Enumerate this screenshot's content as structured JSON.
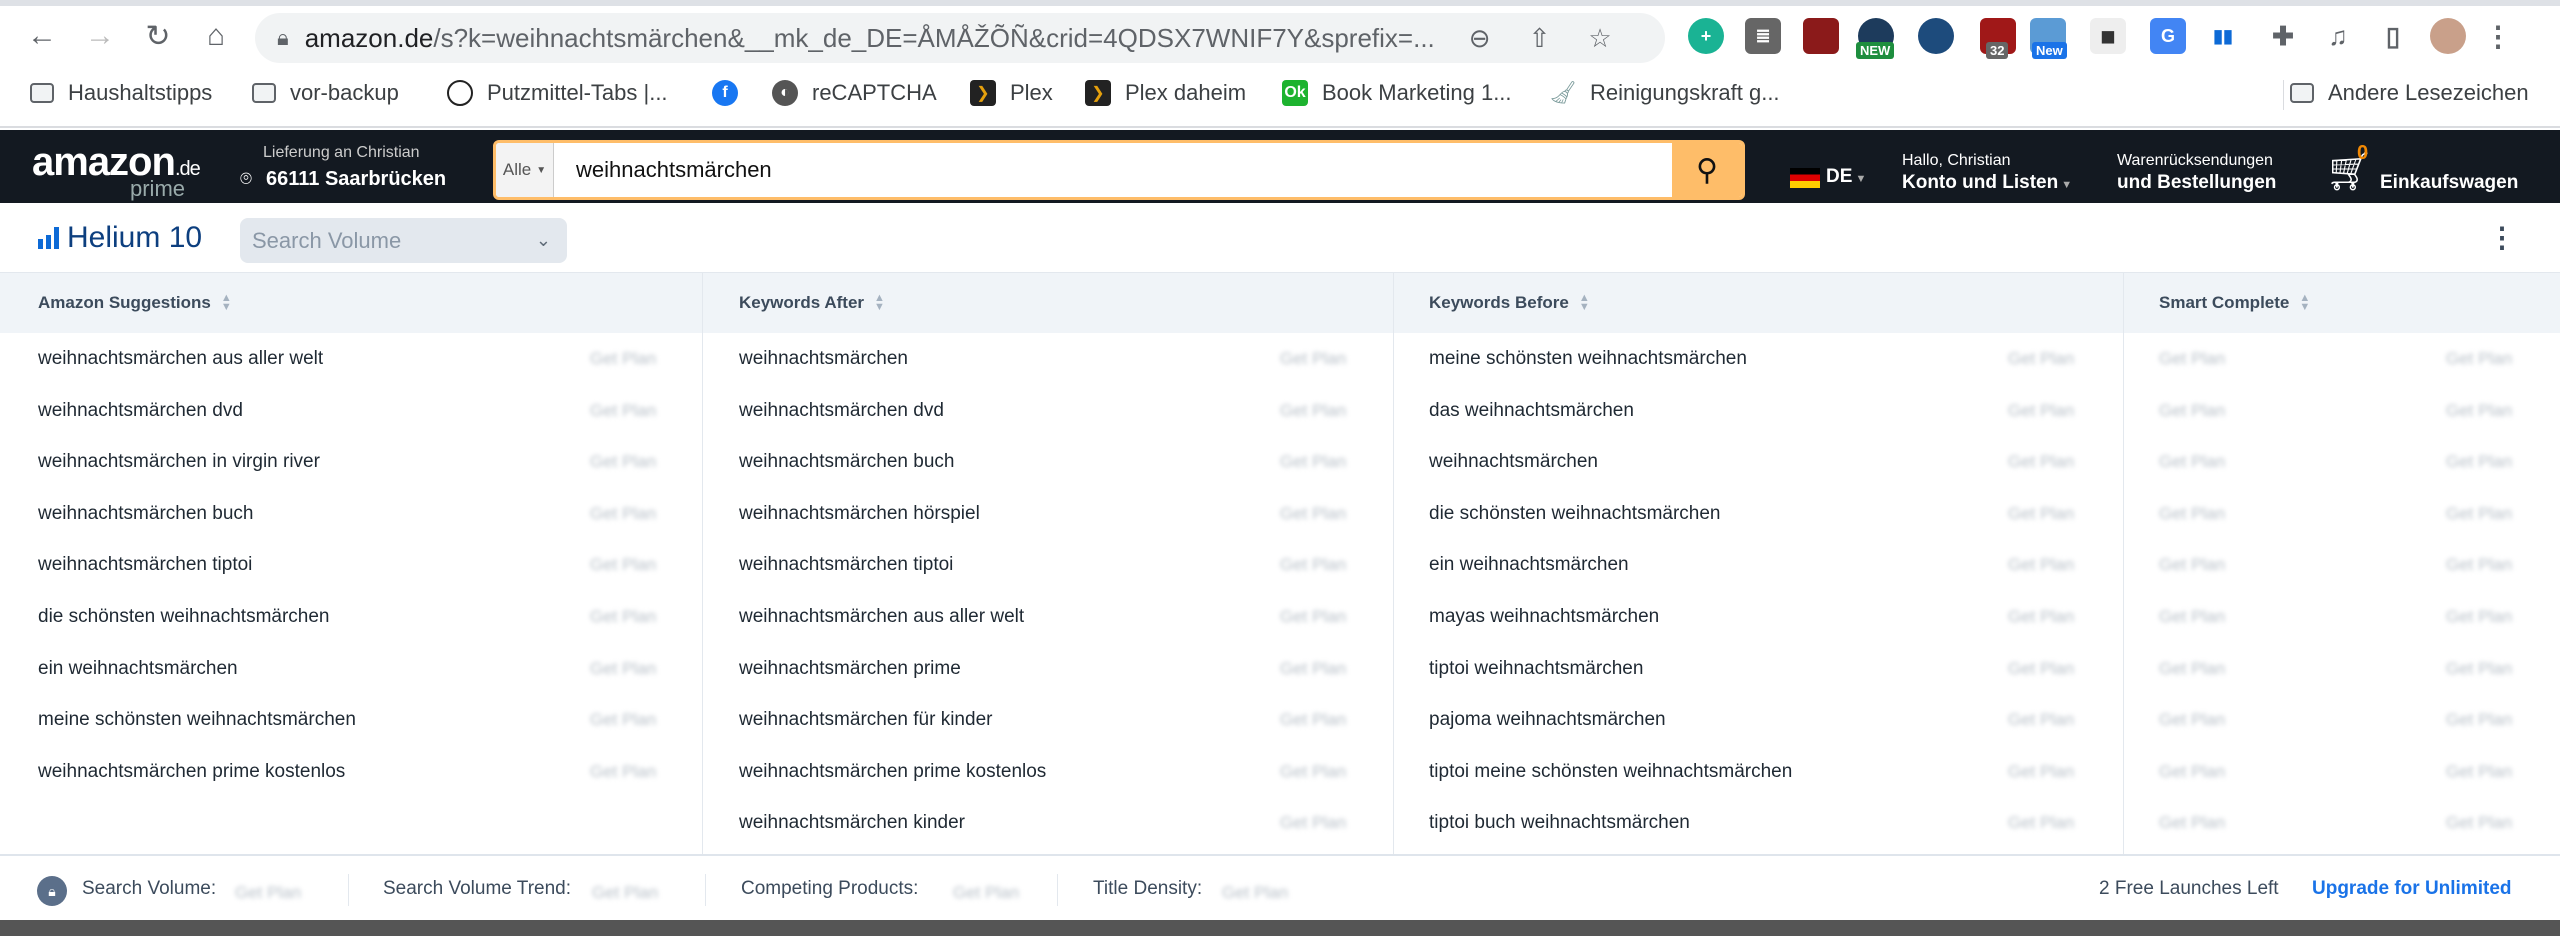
{
  "browser": {
    "url_host": "amazon.de",
    "url_path": "/s?k=weihnachtsmärchen&__mk_de_DE=ÅMÅŽÕÑ&crid=4QDSX7WNIF7Y&sprefix=...",
    "extension_badges": {
      "new1": "NEW",
      "count": "32",
      "new2": "New"
    },
    "bookmarks": [
      {
        "label": "Haushaltstipps",
        "icon": "folder-icon"
      },
      {
        "label": "vor-backup",
        "icon": "folder-icon"
      },
      {
        "label": "Putzmittel-Tabs |...",
        "icon": "drop-icon"
      },
      {
        "label": "",
        "icon": "facebook-icon"
      },
      {
        "label": "reCAPTCHA",
        "icon": "globe-icon"
      },
      {
        "label": "Plex",
        "icon": "plex-icon"
      },
      {
        "label": "Plex daheim",
        "icon": "plex-icon"
      },
      {
        "label": "Book Marketing 1...",
        "icon": "ok-icon"
      },
      {
        "label": "Reinigungskraft g...",
        "icon": "broom-icon"
      }
    ],
    "other_bookmarks": "Andere Lesezeichen"
  },
  "amazon": {
    "logo": "amazon",
    "logo_tld": ".de",
    "logo_prime": "prime",
    "delivery_line1": "Lieferung an Christian",
    "delivery_line2": "66111 Saarbrücken",
    "search_category": "Alle",
    "search_query": "weihnachtsmärchen",
    "lang": "DE",
    "account_line1": "Hallo, Christian",
    "account_line2": "Konto und Listen",
    "orders_line1": "Warenrücksendungen",
    "orders_line2": "und Bestellungen",
    "cart_count": "0",
    "cart_label": "Einkaufswagen"
  },
  "helium": {
    "brand": "Helium 10",
    "metric_select": "Search Volume",
    "columns": [
      {
        "header": "Amazon Suggestions",
        "items": [
          "weihnachtsmärchen aus aller welt",
          "weihnachtsmärchen dvd",
          "weihnachtsmärchen in virgin river",
          "weihnachtsmärchen buch",
          "weihnachtsmärchen tiptoi",
          "die schönsten weihnachtsmärchen",
          "ein weihnachtsmärchen",
          "meine schönsten weihnachtsmärchen",
          "weihnachtsmärchen prime kostenlos"
        ]
      },
      {
        "header": "Keywords After",
        "items": [
          "weihnachtsmärchen",
          "weihnachtsmärchen dvd",
          "weihnachtsmärchen buch",
          "weihnachtsmärchen hörspiel",
          "weihnachtsmärchen tiptoi",
          "weihnachtsmärchen aus aller welt",
          "weihnachtsmärchen prime",
          "weihnachtsmärchen für kinder",
          "weihnachtsmärchen prime kostenlos",
          "weihnachtsmärchen kinder"
        ]
      },
      {
        "header": "Keywords Before",
        "items": [
          "meine schönsten weihnachtsmärchen",
          "das weihnachtsmärchen",
          "weihnachtsmärchen",
          "die schönsten weihnachtsmärchen",
          "ein weihnachtsmärchen",
          "mayas weihnachtsmärchen",
          "tiptoi weihnachtsmärchen",
          "pajoma weihnachtsmärchen",
          "tiptoi meine schönsten weihnachtsmärchen",
          "tiptoi buch weihnachtsmärchen"
        ]
      },
      {
        "header": "Smart Complete",
        "items": []
      }
    ],
    "locked_value": "Get Plan",
    "footer": {
      "search_volume": "Search Volume:",
      "search_volume_trend": "Search Volume Trend:",
      "competing_products": "Competing Products:",
      "title_density": "Title Density:",
      "launches_left": "2 Free Launches Left",
      "upgrade": "Upgrade for Unlimited"
    }
  },
  "colors": {
    "amazon_header": "#131921",
    "search_button": "#febd69",
    "helium_blue": "#0d6ad6",
    "upgrade_link": "#1a73e8"
  }
}
